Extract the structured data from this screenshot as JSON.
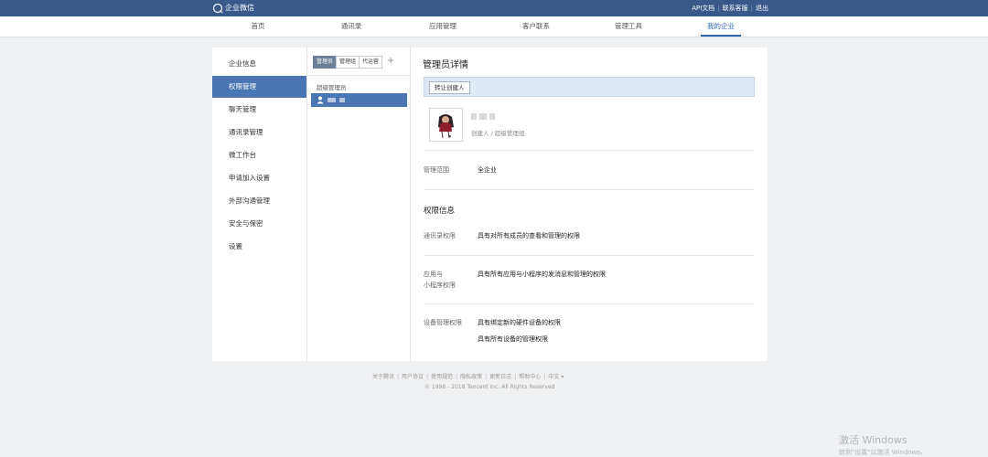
{
  "topbar": {
    "brand": "企业微信",
    "links": [
      "API文档",
      "联系客服",
      "退出"
    ]
  },
  "nav": {
    "items": [
      "首页",
      "通讯录",
      "应用管理",
      "客户联系",
      "管理工具",
      "我的企业"
    ],
    "active": "我的企业"
  },
  "sidebar": {
    "items": [
      "企业信息",
      "权限管理",
      "聊天管理",
      "通讯录管理",
      "微工作台",
      "申请加入设置",
      "外部沟通管理",
      "安全与保密",
      "设置"
    ],
    "active": "权限管理"
  },
  "admin_panel": {
    "tabs": [
      "管理员",
      "管理组",
      "代运营"
    ],
    "active_tab": "管理员",
    "add_icon": "plus-icon",
    "group_label": "超级管理员"
  },
  "detail": {
    "title": "管理员详情",
    "transfer_button": "转让创建人",
    "role": "创建人 / 超级管理组",
    "scope_label": "管理范围",
    "scope_value": "全企业",
    "permissions_title": "权限信息",
    "perm_contacts_label": "通讯录权限",
    "perm_contacts_value": "具有对所有成员的查看和管理的权限",
    "perm_apps_label_1": "应用与",
    "perm_apps_label_2": "小程序权限",
    "perm_apps_value": "具有所有应用与小程序的发消息和管理的权限",
    "perm_devices_label": "设备管理权限",
    "perm_devices_value_1": "具有绑定新的硬件设备的权限",
    "perm_devices_value_2": "具有所有设备的管理权限"
  },
  "footer": {
    "links": [
      "关于腾讯",
      "用户协议",
      "使用规范",
      "隐私政策",
      "更新日志",
      "帮助中心",
      "中文 ▾"
    ],
    "copyright": "© 1998 - 2018 Tencent Inc. All Rights Reserved"
  },
  "watermark": {
    "line1": "激活 Windows",
    "line2": "转到\"设置\"以激活 Windows。"
  },
  "colors": {
    "topbar": "#38598a",
    "accent": "#4a77b4",
    "nav_active": "#2f67b6"
  }
}
